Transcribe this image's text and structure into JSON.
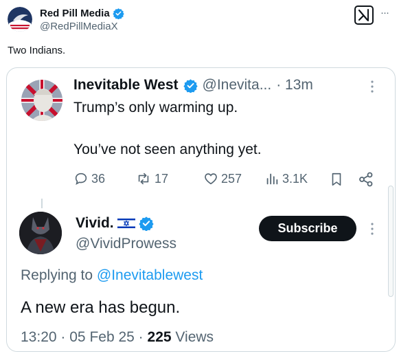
{
  "post": {
    "author_name": "Red Pill Media",
    "author_handle": "@RedPillMediaX",
    "text": "Two Indians.",
    "more_label": "···"
  },
  "quoted": {
    "tweet1": {
      "author_name": "Inevitable West",
      "author_handle": "@Inevita...",
      "time": "· 13m",
      "line1": "Trump’s only warming up.",
      "line2": "You’ve not seen anything yet.",
      "replies": "36",
      "retweets": "17",
      "likes": "257",
      "views": "3.1K"
    },
    "tweet2": {
      "author_name": "Vivid.",
      "author_flag": "🇮🇱",
      "author_handle": "@VividProwess",
      "subscribe_label": "Subscribe",
      "replying_prefix": "Replying to",
      "replying_handle": "@Inevitablewest",
      "text": "A new era has begun.",
      "time": "13:20",
      "date": "05 Feb 25",
      "views_count": "225",
      "views_label": "Views"
    }
  },
  "colors": {
    "verified_blue": "#1d9bf0",
    "text": "#0f1419",
    "secondary": "#536471"
  }
}
